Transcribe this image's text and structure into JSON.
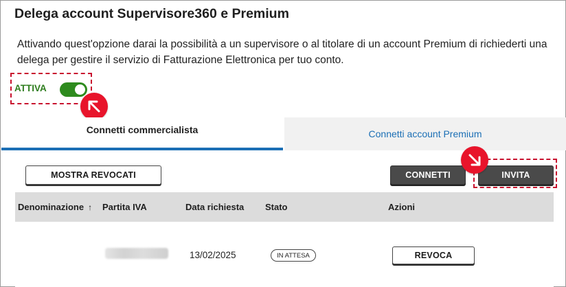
{
  "header": {
    "title": "Delega account Supervisore360 e Premium",
    "description": "Attivando quest'opzione darai la possibilità a un supervisore o al titolare di un account Premium di richiederti una delega per gestire il servizio di Fatturazione Elettronica per tuo conto."
  },
  "toggle": {
    "label": "ATTIVA",
    "state": "on",
    "color": "#2e8b1e"
  },
  "annotations": {
    "badge_color": "#e8142b",
    "highlight_color": "#c8102e"
  },
  "tabs": [
    {
      "label": "Connetti commercialista",
      "active": true
    },
    {
      "label": "Connetti account Premium",
      "active": false
    }
  ],
  "toolbar": {
    "show_revoked_label": "MOSTRA REVOCATI",
    "connect_label": "CONNETTI",
    "invite_label": "INVITA"
  },
  "table": {
    "columns": [
      "Denominazione",
      "Partita IVA",
      "Data richiesta",
      "Stato",
      "Azioni"
    ],
    "sort_indicator": "↑",
    "rows": [
      {
        "denominazione": "",
        "data_richiesta": "13/02/2025",
        "stato": "IN ATTESA",
        "azione": "REVOCA"
      }
    ]
  },
  "colors": {
    "accent": "#1b6fb5",
    "table_header_bg": "#dcdcdc",
    "inactive_tab_bg": "#f1f1f1"
  }
}
